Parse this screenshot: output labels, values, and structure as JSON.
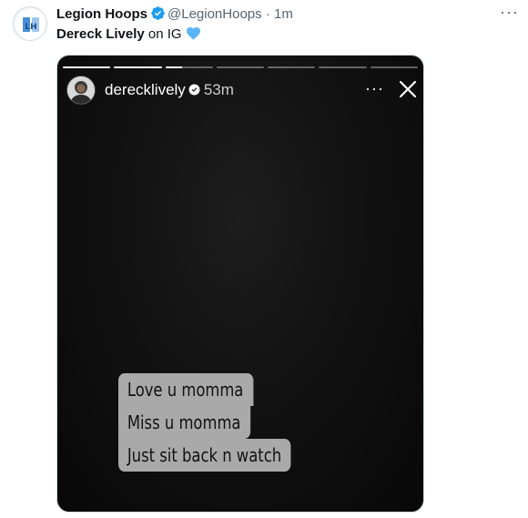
{
  "tweet": {
    "author_name": "Legion Hoops",
    "handle": "@LegionHoops",
    "separator": "·",
    "time": "1m",
    "more_label": "···",
    "text_bold": "Dereck Lively",
    "text_rest": " on IG"
  },
  "story": {
    "username": "derecklively",
    "time": "53m",
    "more_label": "···",
    "progress": [
      1,
      1,
      0.35,
      0,
      0,
      0,
      0
    ],
    "caption_lines": [
      "Love u momma",
      "Miss u momma",
      "Just sit back n watch"
    ]
  },
  "colors": {
    "verified_blue": "#1d9bf0",
    "heart_blue": "#5ab4f5",
    "caption_bg": "#a9a9a9"
  },
  "icons": {
    "verified": "verified-badge-icon",
    "heart": "blue-heart-icon",
    "close": "close-icon",
    "more": "more-icon"
  }
}
